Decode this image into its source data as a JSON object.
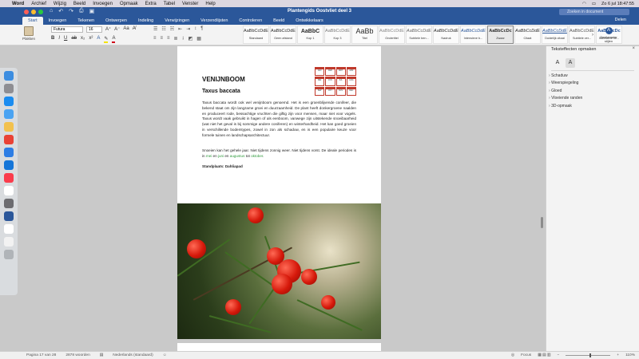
{
  "menubar": {
    "items": [
      "Word",
      "Archief",
      "Wijzig",
      "Beeld",
      "Invoegen",
      "Opmaak",
      "Extra",
      "Tabel",
      "Venster",
      "Help"
    ],
    "clock": "Zo 6 jul 18:47:55"
  },
  "window": {
    "title": "Plantengids Oostvliet deel 3",
    "search_placeholder": "Zoeken in document"
  },
  "tabs": [
    "Start",
    "Invoegen",
    "Tekenen",
    "Ontwerpen",
    "Indeling",
    "Verwijzingen",
    "Verzendlijsten",
    "Controleren",
    "Beeld",
    "Ontwikkelaars"
  ],
  "share_label": "Delen",
  "ribbon": {
    "paste_label": "Plakken",
    "font": "Futura",
    "size": "16",
    "styles": [
      {
        "preview": "AaBbCcDdE",
        "label": "Standaard"
      },
      {
        "preview": "AaBbCcDdE",
        "label": "Geen afstand"
      },
      {
        "preview": "AaBbC",
        "label": "Kop 1"
      },
      {
        "preview": "AaBbCcDdE",
        "label": "Kop 3"
      },
      {
        "preview": "AaBb",
        "label": "Titel"
      },
      {
        "preview": "AaBbCcDdE",
        "label": "Ondertitel"
      },
      {
        "preview": "AaBbCcDdE",
        "label": "Subtiele ben..."
      },
      {
        "preview": "AaBbCcDdE",
        "label": "Nadruk"
      },
      {
        "preview": "AaBbCcDdE",
        "label": "Intensieve b..."
      },
      {
        "preview": "AaBbCcDc",
        "label": "Zwaar"
      },
      {
        "preview": "AaBbCcDdE",
        "label": "Citaat"
      },
      {
        "preview": "AaBbCcDdE",
        "label": "Duidelijk citaat"
      },
      {
        "preview": "AaBbCcDdE",
        "label": "Subtiele ver..."
      },
      {
        "preview": "AaBbCcDc",
        "label": "Intensieve ve..."
      }
    ],
    "pane_button": "Deelvenster stijlen"
  },
  "document": {
    "heading": "VENIJNBOOM",
    "subheading": "Taxus baccata",
    "paragraph1": "Taxus baccata wordt ook wel venijnboom genoemd. Het is een groenblijvende conifeer, die bekend staat om zijn langzame groei en duurzaamheid. De plant heeft donkergroene naalden en produceert rode, bessachtige vruchten die giftig zijn voor mensen, maar niet voor vogels. Taxus wordt vaak gebruikt in hagen of als eenboom, vanwege zijn uitstekende snoeibaarheid (wat niet het geval is bij sommige andere coniferen) en winterhardheid. Het kan goed groeien in verschillende bodemtypes, zowel in zon als schaduw, en is een populaire keuze voor formele tuinen en landschapsarchitectuur.",
    "p2_a": "Snoeien kan het gehele jaar. Niet tijdens zonnig weer. Niet tijdens vorst. De ideale periodes is in ",
    "p2_mei": "mei",
    "p2_b": " en ",
    "p2_juni": "juni",
    "p2_c": " en ",
    "p2_aug": "augustus",
    "p2_d": " tot ",
    "p2_okt": "oktober",
    "p2_e": ".",
    "standplaats": "Standplaats: Dahliapad",
    "calendar": [
      "JAN",
      "FEB",
      "MRT",
      "APR",
      "MEI",
      "JUN",
      "JUL",
      "AUG",
      "SEP",
      "OKT",
      "NOV",
      "DEC"
    ]
  },
  "pane": {
    "title": "Teksteffecten opmaken",
    "items": [
      "Schaduw",
      "Weerspiegeling",
      "Gloed",
      "Vloeiende randen",
      "3D-opmaak"
    ]
  },
  "status": {
    "page": "Pagina 17 van 28",
    "words": "2878 woorden",
    "language": "Nederlands (standaard)",
    "focus": "Focus",
    "zoom": "110%"
  }
}
